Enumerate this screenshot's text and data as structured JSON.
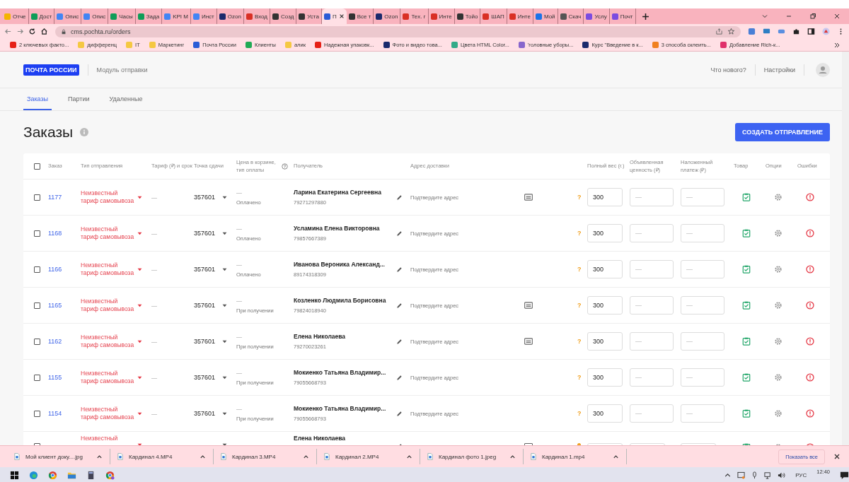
{
  "browser": {
    "tabs": [
      {
        "title": "Отче",
        "color": "#f4b400",
        "selected": false
      },
      {
        "title": "Дост",
        "color": "#0f9d58",
        "selected": false
      },
      {
        "title": "Опис",
        "color": "#4285f4",
        "selected": false
      },
      {
        "title": "Опис",
        "color": "#4285f4",
        "selected": false
      },
      {
        "title": "Часы",
        "color": "#0f9d58",
        "selected": false
      },
      {
        "title": "Зада",
        "color": "#0f9d58",
        "selected": false
      },
      {
        "title": "KPI M",
        "color": "#4285f4",
        "selected": false
      },
      {
        "title": "Инст",
        "color": "#4285f4",
        "selected": false
      },
      {
        "title": "Ozon",
        "color": "#1a2a6c",
        "selected": false
      },
      {
        "title": "Вход",
        "color": "#d93025",
        "selected": false
      },
      {
        "title": "Созд",
        "color": "#333333",
        "selected": false
      },
      {
        "title": "Уста",
        "color": "#333333",
        "selected": false
      },
      {
        "title": "П",
        "color": "#2b5cd6",
        "selected": true
      },
      {
        "title": "Все т",
        "color": "#333333",
        "selected": false
      },
      {
        "title": "Ozon",
        "color": "#1a2a6c",
        "selected": false
      },
      {
        "title": "Тех. г",
        "color": "#d93025",
        "selected": false
      },
      {
        "title": "Инте",
        "color": "#d93025",
        "selected": false
      },
      {
        "title": "Тойо",
        "color": "#333333",
        "selected": false
      },
      {
        "title": "ШАП",
        "color": "#d93025",
        "selected": false
      },
      {
        "title": "Инте",
        "color": "#d93025",
        "selected": false
      },
      {
        "title": "Мой",
        "color": "#1a73e8",
        "selected": false
      },
      {
        "title": "Скач",
        "color": "#555555",
        "selected": false
      },
      {
        "title": "Услу",
        "color": "#7b4ce0",
        "selected": false
      },
      {
        "title": "Почт",
        "color": "#7b4ce0",
        "selected": false
      }
    ],
    "address": "cms.pochta.ru/orders",
    "bookmarks": [
      {
        "title": "2 ключевых факто...",
        "color": "#e62117"
      },
      {
        "title": "дифференц",
        "color": "#f5c842"
      },
      {
        "title": "IT",
        "color": "#f5c842"
      },
      {
        "title": "Маркетинг",
        "color": "#f5c842"
      },
      {
        "title": "Почта России",
        "color": "#2b5cd6"
      },
      {
        "title": "Клиенты",
        "color": "#22aa55"
      },
      {
        "title": "алик",
        "color": "#f5c842"
      },
      {
        "title": "Надежная упаковк...",
        "color": "#e62117"
      },
      {
        "title": "Фото и видео това...",
        "color": "#1a2a6c"
      },
      {
        "title": "Цвета HTML Color...",
        "color": "#33aa88"
      },
      {
        "title": "'головные уборы...",
        "color": "#8866cc"
      },
      {
        "title": "Курс \"Введение в к...",
        "color": "#1a2a6c"
      },
      {
        "title": "3 способа склеить...",
        "color": "#f08020"
      },
      {
        "title": "Добавление Rich-к...",
        "color": "#e0306a"
      }
    ]
  },
  "header": {
    "logo": "ПОЧТА РОССИИ",
    "module": "Модуль отправки",
    "links": [
      "Что нового?",
      "Настройки"
    ]
  },
  "tabs": [
    {
      "label": "Заказы",
      "selected": true
    },
    {
      "label": "Партии",
      "selected": false
    },
    {
      "label": "Удаленные",
      "selected": false
    }
  ],
  "title": "Заказы",
  "create_button": "СОЗДАТЬ ОТПРАВЛЕНИЕ",
  "table": {
    "select_all_checked": false,
    "columns": [
      "Заказ",
      "Тип отправления",
      "Тариф (₽) и срок",
      "Точка сдачи",
      "Цена в корзине, тип оплаты",
      "Получатель",
      "Адрес доставки",
      "Полный вес (г.)",
      "Объявленная ценность (₽)",
      "Наложенный платеж (₽)",
      "Товар",
      "Опции",
      "Ошибки"
    ],
    "rows": [
      {
        "kind": "full",
        "checked": false,
        "order": "1177",
        "type": "Неизвестный тариф самовывоза",
        "tariff": "—",
        "point": "357601",
        "price": "—",
        "payment": "Оплачено",
        "recipient": "Ларина Екатерина Сергеевна",
        "phone": "79271297880",
        "address": "Подтвердите адрес",
        "has_card": true,
        "hint": "?",
        "weight": "300",
        "declared_placeholder": "—",
        "cod_placeholder": "—"
      },
      {
        "kind": "full",
        "checked": false,
        "order": "1168",
        "type": "Неизвестный тариф самовывоза",
        "tariff": "—",
        "point": "357601",
        "price": "—",
        "payment": "Оплачено",
        "recipient": "Усламина Елена Викторовна",
        "phone": "79857667389",
        "address": "Подтвердите адрес",
        "has_card": false,
        "hint": "?",
        "weight": "300",
        "declared_placeholder": "—",
        "cod_placeholder": "—"
      },
      {
        "kind": "full",
        "checked": false,
        "order": "1166",
        "type": "Неизвестный тариф самовывоза",
        "tariff": "—",
        "point": "357601",
        "price": "—",
        "payment": "Оплачено",
        "recipient": "Иванова Вероника Александ...",
        "phone": "89174318309",
        "address": "Подтвердите адрес",
        "has_card": false,
        "hint": "?",
        "weight": "300",
        "declared_placeholder": "—",
        "cod_placeholder": "—"
      },
      {
        "kind": "full",
        "checked": false,
        "order": "1165",
        "type": "Неизвестный тариф самовывоза",
        "tariff": "—",
        "point": "357601",
        "price": "—",
        "payment": "При получении",
        "recipient": "Козленко Людмила Борисовна",
        "phone": "79824018940",
        "address": "Подтвердите адрес",
        "has_card": true,
        "hint": "?",
        "weight": "300",
        "declared_placeholder": "—",
        "cod_placeholder": "—"
      },
      {
        "kind": "full",
        "checked": false,
        "order": "1162",
        "type": "Неизвестный тариф самовывоза",
        "tariff": "—",
        "point": "357601",
        "price": "—",
        "payment": "При получении",
        "recipient": "Елена Николаева",
        "phone": "79270023261",
        "address": "Подтвердите адрес",
        "has_card": true,
        "hint": "?",
        "weight": "300",
        "declared_placeholder": "—",
        "cod_placeholder": "—"
      },
      {
        "kind": "full",
        "checked": false,
        "order": "1155",
        "type": "Неизвестный тариф самовывоза",
        "tariff": "—",
        "point": "357601",
        "price": "—",
        "payment": "При получении",
        "recipient": "Мокиенко Татьяна Владимир...",
        "phone": "79055668793",
        "address": "Подтвердите адрес",
        "has_card": false,
        "hint": "?",
        "weight": "300",
        "declared_placeholder": "—",
        "cod_placeholder": "—"
      },
      {
        "kind": "full",
        "checked": false,
        "order": "1154",
        "type": "Неизвестный тариф самовывоза",
        "tariff": "—",
        "point": "357601",
        "price": "—",
        "payment": "При получении",
        "recipient": "Мокиенко Татьяна Владимир...",
        "phone": "79055668793",
        "address": "Подтвердите адрес",
        "has_card": false,
        "hint": "?",
        "weight": "300",
        "declared_placeholder": "—",
        "cod_placeholder": "—"
      },
      {
        "kind": "partial",
        "checked": false,
        "type": "Неизвестный",
        "recipient": "Елена Николаева"
      }
    ]
  },
  "downloads": {
    "items": [
      "Мой клиент доку....jpg",
      "Кардинал 4.MP4",
      "Кардинал 3.MP4",
      "Кардинал 2.MP4",
      "Кардинал фото 1.jpeg",
      "Кардинал 1.mp4"
    ],
    "show_all": "Показать все"
  },
  "taskbar": {
    "language": "РУС",
    "time": "12:40"
  }
}
